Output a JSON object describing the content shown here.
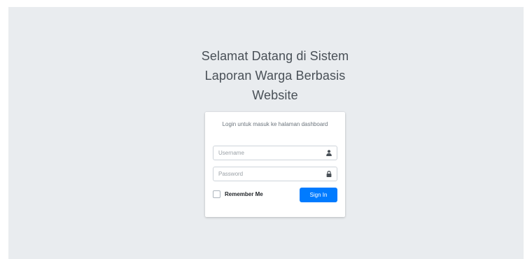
{
  "page": {
    "background_color": "#e9ecef"
  },
  "login": {
    "title_lines": [
      "Selamat Datang di Sistem",
      "Laporan Warga Berbasis",
      "Website"
    ],
    "message": "Login untuk masuk ke halaman dashboard",
    "username": {
      "placeholder": "Username",
      "value": "",
      "icon": "user-icon"
    },
    "password": {
      "placeholder": "Password",
      "value": "",
      "icon": "lock-icon"
    },
    "remember_label": "Remember Me",
    "remember_checked": false,
    "signin_label": "Sign In",
    "accent_color": "#007bff"
  }
}
